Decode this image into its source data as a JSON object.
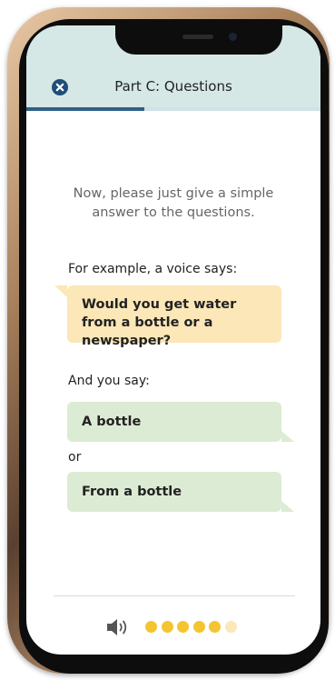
{
  "header": {
    "title": "Part C: Questions",
    "close_icon": "close-icon",
    "progress_fraction": 0.4
  },
  "content": {
    "intro": "Now, please just give a simple answer to the questions.",
    "example_label": "For example, a voice says:",
    "example_question": "Would you get water from a bottle or a newspaper?",
    "answer_label": "And you say:",
    "answer_1": "A bottle",
    "or_label": "or",
    "answer_2": "From a bottle"
  },
  "footer": {
    "audio_icon": "speaker-icon",
    "dots_total": 6,
    "dots_filled": 5
  },
  "colors": {
    "header_bg": "#d5e8e6",
    "progress_fill": "#2f6086",
    "question_bubble": "#fbe7b7",
    "answer_bubble": "#dcebd3",
    "dot_filled": "#f5c431",
    "dot_empty": "#fbe7b7"
  }
}
